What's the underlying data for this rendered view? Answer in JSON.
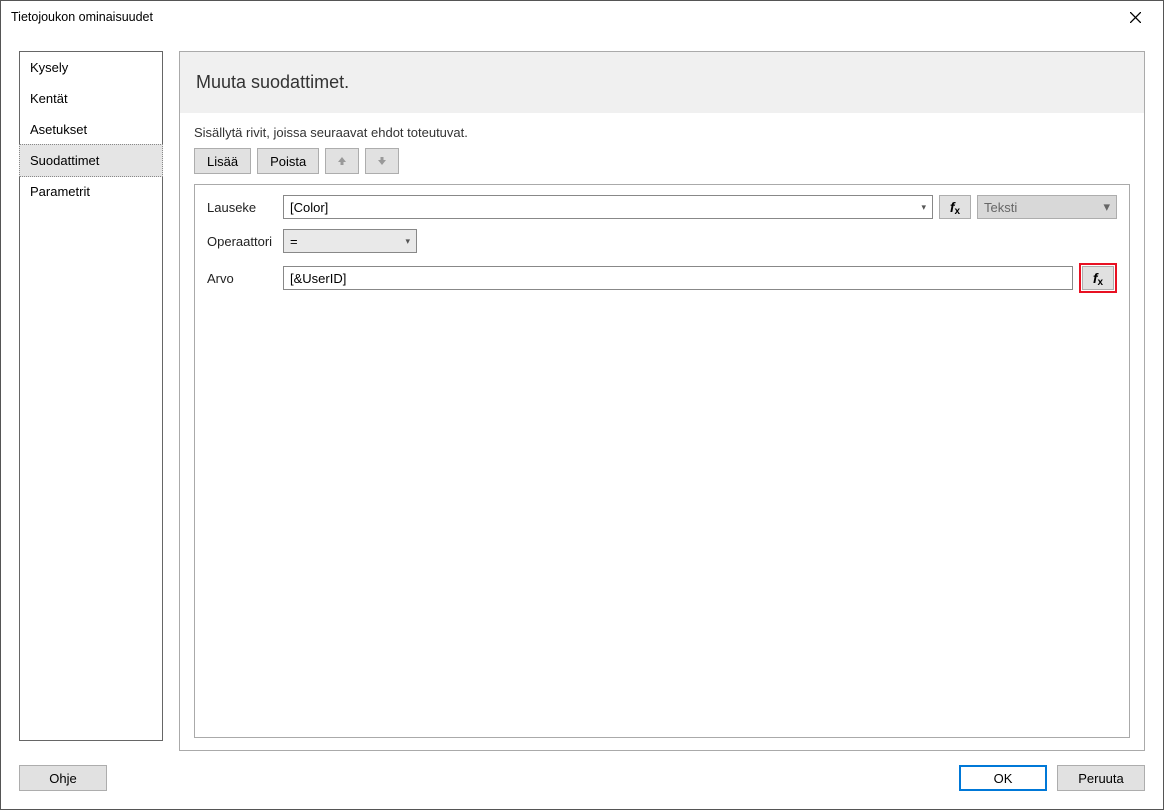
{
  "window": {
    "title": "Tietojoukon ominaisuudet"
  },
  "sidebar": {
    "items": [
      {
        "label": "Kysely"
      },
      {
        "label": "Kentät"
      },
      {
        "label": "Asetukset"
      },
      {
        "label": "Suodattimet"
      },
      {
        "label": "Parametrit"
      }
    ],
    "selected_index": 3
  },
  "content": {
    "heading": "Muuta suodattimet.",
    "instruction": "Sisällytä rivit, joissa seuraavat ehdot toteutuvat.",
    "toolbar": {
      "add": "Lisää",
      "remove": "Poista"
    },
    "filter": {
      "expression_label": "Lauseke",
      "expression_value": "[Color]",
      "datatype_value": "Teksti",
      "operator_label": "Operaattori",
      "operator_value": "=",
      "value_label": "Arvo",
      "value_value": "[&UserID]"
    }
  },
  "footer": {
    "help": "Ohje",
    "ok": "OK",
    "cancel": "Peruuta"
  },
  "icons": {
    "fx_label": "fx"
  }
}
